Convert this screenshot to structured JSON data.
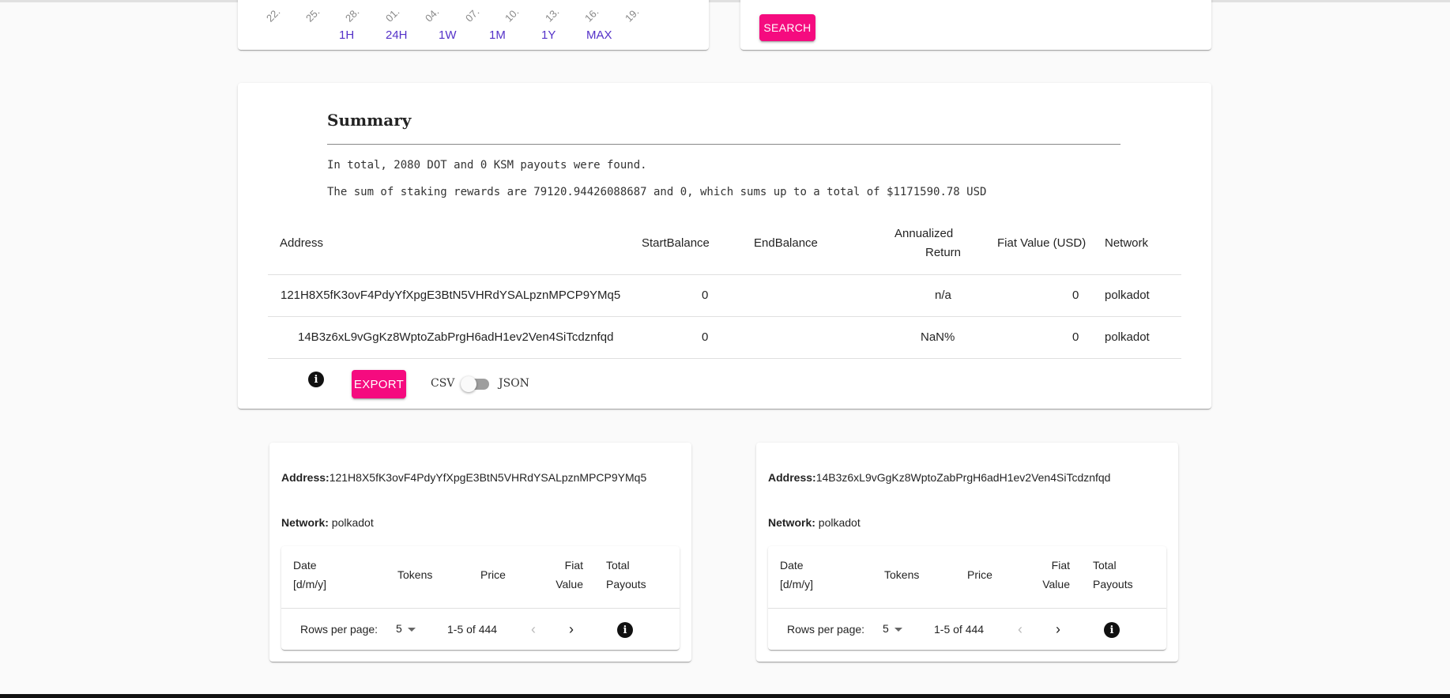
{
  "chart": {
    "ticks": [
      "22.",
      "25.",
      "28.",
      "01.",
      "04.",
      "07.",
      "10.",
      "13.",
      "16.",
      "19."
    ],
    "ranges": [
      "1H",
      "24H",
      "1W",
      "1M",
      "1Y",
      "MAX"
    ]
  },
  "search": {
    "button_label": "SEARCH"
  },
  "summary": {
    "title": "Summary",
    "line1": "In total, 2080 DOT and 0 KSM payouts were found.",
    "line2": "The sum of staking rewards are 79120.94426088687 and 0, which sums up to a total of $1171590.78 USD",
    "table": {
      "headers": {
        "address": "Address",
        "start_balance": "StartBalance",
        "end_balance": "EndBalance",
        "annualized_line1": "Annualized",
        "annualized_line2": "Return",
        "fiat_value": "Fiat Value (USD)",
        "network": "Network"
      },
      "rows": [
        {
          "address": "121H8X5fK3ovF4PdyYfXpgE3BtN5VHRdYSALpznMPCP9YMq5",
          "start_balance": "0",
          "end_balance": "",
          "annualized": "n/a",
          "fiat_value": "0",
          "network": "polkadot"
        },
        {
          "address": "14B3z6xL9vGgKz8WptoZabPrgH6adH1ev2Ven4SiTcdznfqd",
          "start_balance": "0",
          "end_balance": "",
          "annualized": "NaN%",
          "fiat_value": "0",
          "network": "polkadot"
        }
      ]
    },
    "export_label": "EXPORT",
    "toggle_left": "CSV",
    "toggle_right": "JSON"
  },
  "accounts": [
    {
      "address_label": "Address:",
      "address": "121H8X5fK3ovF4PdyYfXpgE3BtN5VHRdYSALpznMPCP9YMq5",
      "network_label": "Network:",
      "network": "polkadot",
      "headers": {
        "date_line1": "Date",
        "date_line2": "[d/m/y]",
        "tokens": "Tokens",
        "price": "Price",
        "fiat_line1": "Fiat",
        "fiat_line2": "Value",
        "total_line1": "Total",
        "total_line2": "Payouts"
      },
      "rows_per_page_label": "Rows per page:",
      "rows_per_page": "5",
      "range": "1-5 of 444"
    },
    {
      "address_label": "Address:",
      "address": "14B3z6xL9vGgKz8WptoZabPrgH6adH1ev2Ven4SiTcdznfqd",
      "network_label": "Network:",
      "network": "polkadot",
      "headers": {
        "date_line1": "Date",
        "date_line2": "[d/m/y]",
        "tokens": "Tokens",
        "price": "Price",
        "fiat_line1": "Fiat",
        "fiat_line2": "Value",
        "total_line1": "Total",
        "total_line2": "Payouts"
      },
      "rows_per_page_label": "Rows per page:",
      "rows_per_page": "5",
      "range": "1-5 of 444"
    }
  ],
  "colors": {
    "accent": "#f50b7f",
    "range_link": "#5431c8"
  }
}
